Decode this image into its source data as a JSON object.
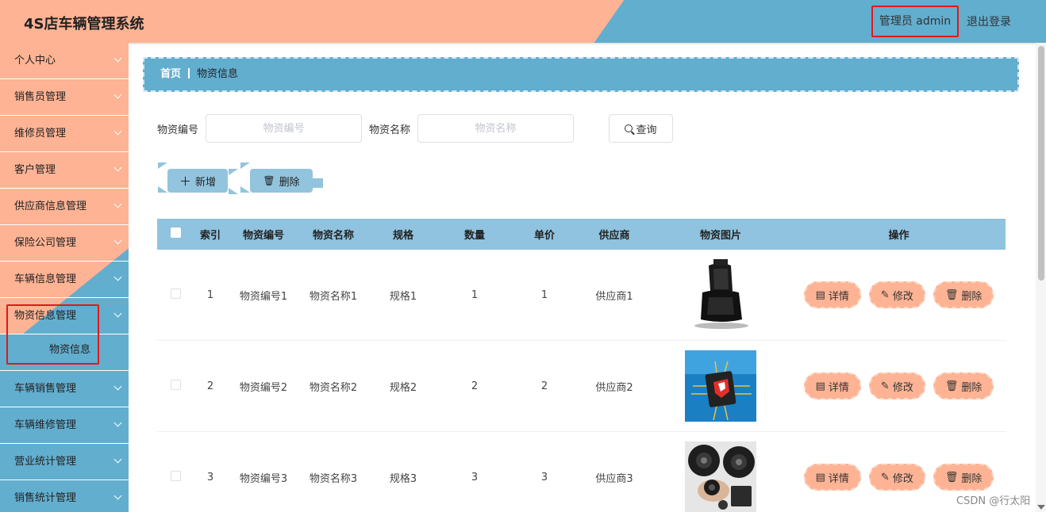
{
  "app": {
    "title": "4S店车辆管理系统"
  },
  "header": {
    "user_label": "管理员 admin",
    "logout_label": "退出登录"
  },
  "sidebar": {
    "items": [
      {
        "label": "个人中心"
      },
      {
        "label": "销售员管理"
      },
      {
        "label": "维修员管理"
      },
      {
        "label": "客户管理"
      },
      {
        "label": "供应商信息管理"
      },
      {
        "label": "保险公司管理"
      },
      {
        "label": "车辆信息管理"
      },
      {
        "label": "物资信息管理"
      },
      {
        "label": "车辆销售管理"
      },
      {
        "label": "车辆维修管理"
      },
      {
        "label": "营业统计管理"
      },
      {
        "label": "销售统计管理"
      }
    ],
    "active_submenu": "物资信息"
  },
  "breadcrumb": {
    "home": "首页",
    "current": "物资信息"
  },
  "search": {
    "code_label": "物资编号",
    "code_placeholder": "物资编号",
    "name_label": "物资名称",
    "name_placeholder": "物资名称",
    "query_label": "查询"
  },
  "actions": {
    "add_label": "新增",
    "delete_label": "删除"
  },
  "table": {
    "headers": [
      "索引",
      "物资编号",
      "物资名称",
      "规格",
      "数量",
      "单价",
      "供应商",
      "物资图片",
      "操作"
    ],
    "rows": [
      {
        "index": "1",
        "code": "物资编号1",
        "name": "物资名称1",
        "spec": "规格1",
        "qty": "1",
        "price": "1",
        "supplier": "供应商1",
        "image": "car-seat"
      },
      {
        "index": "2",
        "code": "物资编号2",
        "name": "物资名称2",
        "spec": "规格2",
        "qty": "2",
        "price": "2",
        "supplier": "供应商2",
        "image": "chip"
      },
      {
        "index": "3",
        "code": "物资编号3",
        "name": "物资名称3",
        "spec": "规格3",
        "qty": "3",
        "price": "3",
        "supplier": "供应商3",
        "image": "speakers"
      }
    ],
    "row_actions": {
      "detail": "详情",
      "edit": "修改",
      "delete": "删除"
    }
  },
  "watermark": "CSDN @行太阳",
  "colors": {
    "salmon": "#fdb394",
    "blue": "#62aecf",
    "table_header": "#8fc3df",
    "highlight": "#e21818"
  }
}
